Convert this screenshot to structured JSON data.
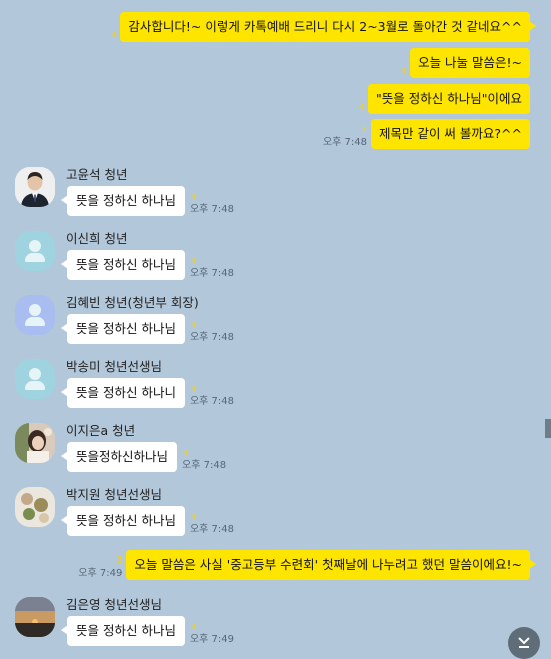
{
  "outgoing": [
    {
      "text": "감사합니다!~ 이렇게 카톡예배 드리니 다시 2~3월로 돌아간 것 같네요^^",
      "unread": "3",
      "time": ""
    },
    {
      "text": "오늘 나눌 말씀은!~",
      "unread": "3",
      "time": ""
    },
    {
      "text": "\"뜻을 정하신 하나님\"이에요",
      "unread": "3",
      "time": ""
    },
    {
      "text": "제목만 같이 써 볼까요?^^",
      "unread": "3",
      "time": "오후 7:48"
    }
  ],
  "incoming": [
    {
      "sender": "고윤석 청년",
      "text": "뜻을 정하신 하나님",
      "unread": "3",
      "time": "오후 7:48",
      "avatar": "profile-photo"
    },
    {
      "sender": "이신희 청년",
      "text": "뜻을 정하신 하나님",
      "unread": "3",
      "time": "오후 7:48",
      "avatar": "default-person-icon"
    },
    {
      "sender": "김혜빈 청년(청년부 회장)",
      "text": "뜻을 정하신 하나님",
      "unread": "3",
      "time": "오후 7:48",
      "avatar": "default-person-icon"
    },
    {
      "sender": "박송미 청년선생님",
      "text": "뜻을 정하신 하나니",
      "unread": "3",
      "time": "오후 7:48",
      "avatar": "default-person-icon"
    },
    {
      "sender": "이지은a 청년",
      "text": "뜻을정하신하나님",
      "unread": "3",
      "time": "오후 7:48",
      "avatar": "profile-photo"
    },
    {
      "sender": "박지원 청년선생님",
      "text": "뜻을 정하신 하나님",
      "unread": "3",
      "time": "오후 7:48",
      "avatar": "profile-photo"
    }
  ],
  "outgoing_late": {
    "text": "오늘 말씀은 사실 '중고등부 수련회' 첫째날에 나누려고 했던 말씀이에요!~",
    "unread": "3",
    "time": "오후 7:49"
  },
  "incoming_late": {
    "sender": "김은영 청년선생님",
    "text": "뜻을 정하신 하나님",
    "unread": "3",
    "time": "오후 7:49",
    "avatar": "sunset-photo"
  },
  "scroll_down_icon": "double-chevron-down-icon",
  "colors": {
    "background": "#b2c7d9",
    "my_bubble": "#fee500",
    "their_bubble": "#ffffff",
    "unread": "#f2cf22"
  }
}
